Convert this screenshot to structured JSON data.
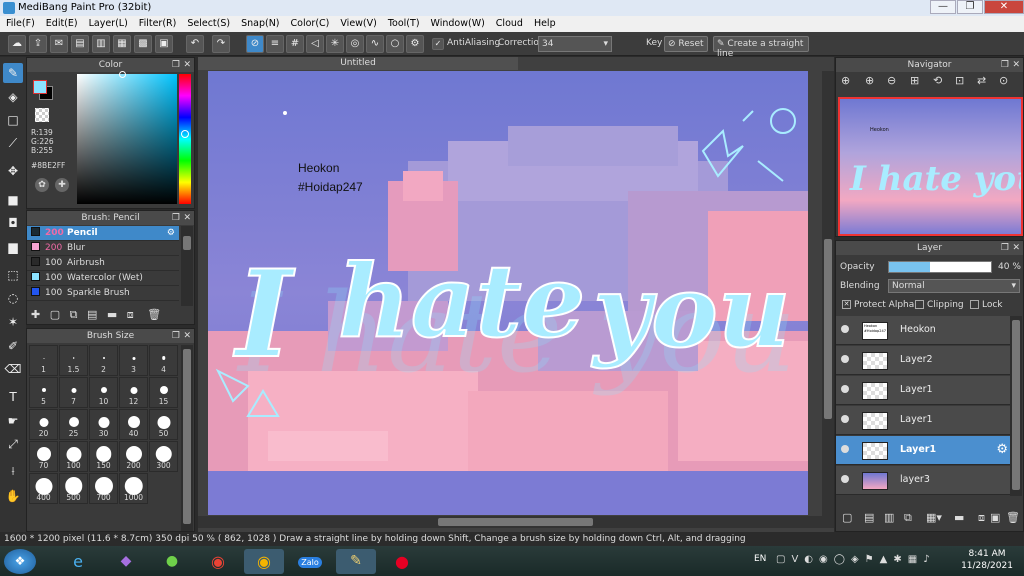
{
  "window": {
    "title": "MediBang Paint Pro (32bit)",
    "min": "—",
    "max": "❐",
    "close": "✕"
  },
  "menu": [
    "File(F)",
    "Edit(E)",
    "Layer(L)",
    "Filter(R)",
    "Select(S)",
    "Snap(N)",
    "Color(C)",
    "View(V)",
    "Tool(T)",
    "Window(W)",
    "Cloud",
    "Help"
  ],
  "toolbar": {
    "antialiasing_label": "AntiAliasing",
    "correction_label": "Correction",
    "correction_value": "34",
    "key_label": "Key",
    "reset_label": "Reset",
    "straight_line_label": "Create a straight line"
  },
  "color_panel": {
    "title": "Color",
    "r": "R:139",
    "g": "G:226",
    "b": "B:255",
    "hex": "#8BE2FF",
    "fg": "#8be2ff",
    "bg": "#000000"
  },
  "brush_panel": {
    "title": "Brush: Pencil",
    "items": [
      {
        "size": "200",
        "name": "Pencil",
        "color": "#1a2a33"
      },
      {
        "size": "200",
        "name": "Blur",
        "color": "#f7a3d2"
      },
      {
        "size": "100",
        "name": "Airbrush",
        "color": "#2a2a2a"
      },
      {
        "size": "100",
        "name": "Watercolor (Wet)",
        "color": "#8be2ff"
      },
      {
        "size": "100",
        "name": "Sparkle Brush",
        "color": "#2255ee"
      }
    ]
  },
  "brush_size_panel": {
    "title": "Brush Size",
    "sizes": [
      "1",
      "1.5",
      "2",
      "3",
      "4",
      "5",
      "7",
      "10",
      "12",
      "15",
      "20",
      "25",
      "30",
      "40",
      "50",
      "70",
      "100",
      "150",
      "200",
      "300",
      "400",
      "500",
      "700",
      "1000"
    ]
  },
  "canvas": {
    "tab": "Untitled",
    "text_heokon": "Heokon",
    "text_tag": "#Hoidap247",
    "art_title": "I hate you",
    "art_title_words": [
      "I",
      "hate",
      "you"
    ]
  },
  "navigator": {
    "title": "Navigator"
  },
  "layer_panel": {
    "title": "Layer",
    "opacity_label": "Opacity",
    "opacity_value": "40 %",
    "opacity": 0.4,
    "blending_label": "Blending",
    "blending_value": "Normal",
    "protect_alpha": "Protect Alpha",
    "clipping": "Clipping",
    "lock": "Lock",
    "layers": [
      {
        "name": "Heokon",
        "thumb_text": "Heokon #Hoidap247"
      },
      {
        "name": "Layer2"
      },
      {
        "name": "Layer1"
      },
      {
        "name": "Layer1"
      },
      {
        "name": "Layer1",
        "selected": true
      },
      {
        "name": "layer3"
      }
    ]
  },
  "status": {
    "dims": "1600 * 1200 pixel",
    "cm": "(11.6 * 8.7cm)",
    "dpi": "350 dpi",
    "zoom": "50 %",
    "coords": "( 862, 1028 )",
    "hint": "Draw a straight line by holding down Shift, Change a brush size by holding down Ctrl, Alt, and dragging"
  },
  "taskbar": {
    "lang": "EN",
    "time": "8:41 AM",
    "date": "11/28/2021",
    "apps": [
      "start",
      "ie",
      "visual-studio",
      "green-app",
      "chrome",
      "chrome-canary",
      "zalo",
      "paint",
      "pinterest"
    ],
    "zalo_label": "Zalo"
  }
}
